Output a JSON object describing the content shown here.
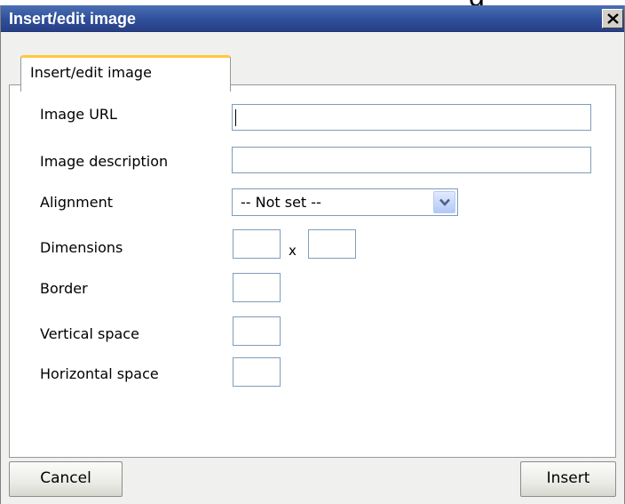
{
  "background": {
    "partial_glyph": "g"
  },
  "dialog": {
    "title": "Insert/edit image",
    "close_icon": "close-x-icon",
    "colors": {
      "titlebar": "#2f4f9a",
      "body": "#f0f0ee",
      "tab_accent": "#ffc83c",
      "input_border": "#7f9db9"
    }
  },
  "tab": {
    "label": "Insert/edit image"
  },
  "fields": {
    "image_url": {
      "label": "Image URL",
      "value": ""
    },
    "image_description": {
      "label": "Image description",
      "value": ""
    },
    "alignment": {
      "label": "Alignment",
      "selected": "-- Not set --",
      "dropdown_icon": "chevron-down-icon"
    },
    "dimensions": {
      "label": "Dimensions",
      "width": "",
      "separator": "x",
      "height": ""
    },
    "border": {
      "label": "Border",
      "value": ""
    },
    "vertical_space": {
      "label": "Vertical space",
      "value": ""
    },
    "horizontal_space": {
      "label": "Horizontal space",
      "value": ""
    }
  },
  "buttons": {
    "cancel": "Cancel",
    "insert": "Insert"
  }
}
